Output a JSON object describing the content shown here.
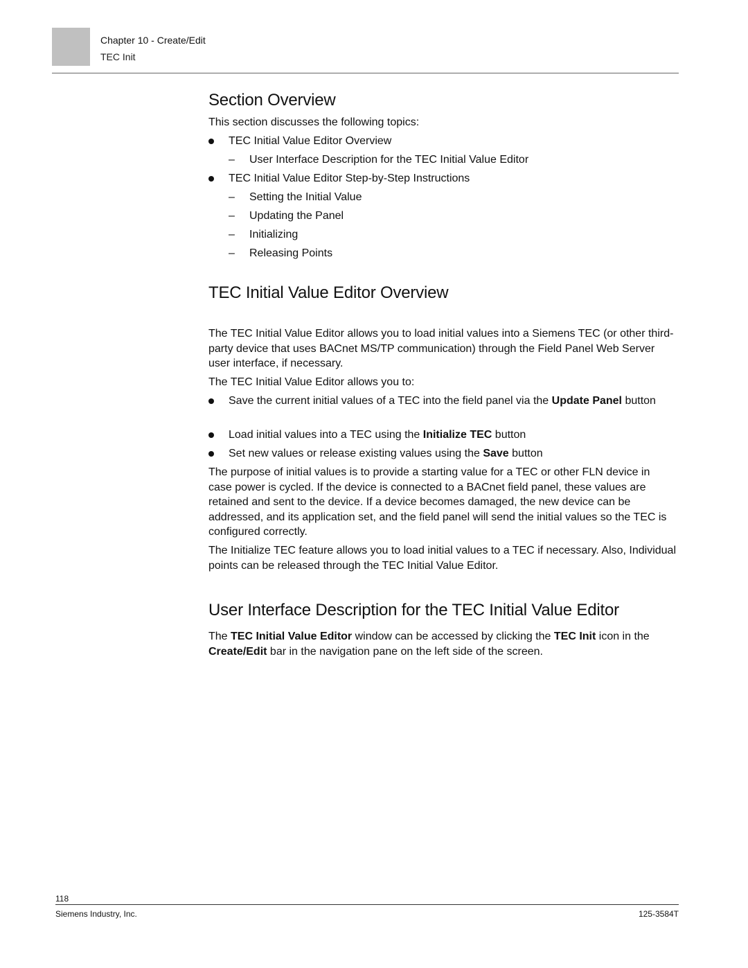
{
  "header": {
    "chapter": "Chapter 10 - Create/Edit",
    "subtitle": "TEC Init"
  },
  "section_overview": {
    "title": "Section Overview",
    "intro": "This section discusses the following topics:",
    "topics": [
      {
        "label": "TEC Initial Value Editor Overview",
        "subtopics": [
          "User Interface Description for the TEC Initial Value Editor"
        ]
      },
      {
        "label": "TEC Initial Value Editor Step-by-Step Instructions",
        "subtopics": [
          "Setting the Initial Value",
          "Updating the Panel",
          "Initializing",
          "Releasing Points"
        ]
      }
    ]
  },
  "editor_overview": {
    "title": "TEC Initial Value Editor Overview",
    "para1": "The TEC Initial Value Editor allows you to load initial values into a Siemens TEC (or other third-party device that uses BACnet MS/TP communication) through the Field Panel Web Server user interface, if necessary.",
    "para2": "The TEC Initial Value Editor allows you to:",
    "bullets": [
      {
        "pre": "Save the current initial values of a TEC into the field panel via the ",
        "bold": "Update Panel",
        "post": " button"
      },
      {
        "pre": "Load initial values into a TEC using the ",
        "bold": "Initialize TEC",
        "post": " button"
      },
      {
        "pre": "Set new values or release existing values using the ",
        "bold": "Save",
        "post": " button"
      }
    ],
    "para3": "The purpose of initial values is to provide a starting value for a TEC or other FLN device in case power is cycled. If the device is connected to a BACnet field panel, these values are retained and sent to the device. If a device becomes damaged, the new device can be addressed, and its application set, and the field panel will send the initial values so the TEC is configured correctly.",
    "para4": "The Initialize TEC feature allows you to load initial values to a TEC if necessary. Also, Individual points can be released through the TEC Initial Value Editor."
  },
  "ui_description": {
    "title": "User Interface Description for the TEC Initial Value Editor",
    "parts": {
      "t1": "The ",
      "b1": "TEC Initial Value Editor",
      "t2": " window can be accessed by clicking the ",
      "b2": "TEC Init",
      "t3": " icon in the ",
      "b3": "Create/Edit",
      "t4": " bar in the navigation pane on the left side of the screen."
    }
  },
  "footer": {
    "page_number": "118",
    "company": "Siemens Industry, Inc.",
    "doc_number": "125-3584T"
  }
}
